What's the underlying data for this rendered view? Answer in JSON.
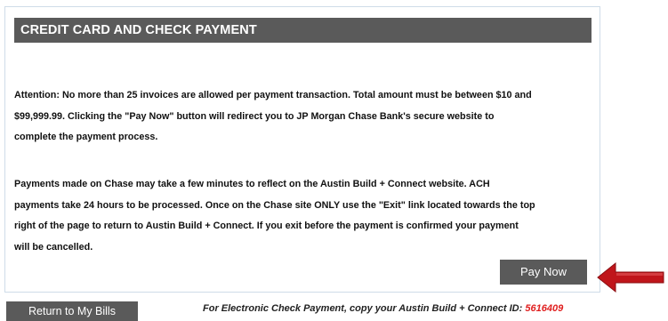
{
  "panel": {
    "title": "CREDIT CARD AND CHECK PAYMENT",
    "paragraph1_lines": [
      "Attention:  No more than 25 invoices are allowed per payment transaction.  Total amount must be between $10 and",
      "$99,999.99.  Clicking the \"Pay Now\" button will redirect you to JP Morgan Chase Bank's secure website to",
      "complete the payment process."
    ],
    "paragraph2_lines": [
      "Payments made on Chase may take a few minutes to reflect on the Austin Build + Connect website.  ACH",
      "payments take 24 hours to be processed. Once on the Chase site ONLY use the \"Exit\" link located towards the top",
      "right of the page to return to Austin Build + Connect.  If you exit before the payment is confirmed your payment",
      "will be cancelled."
    ],
    "pay_now_label": "Pay Now"
  },
  "arrow": {
    "icon": "left-arrow-icon",
    "color": "#c0151b"
  },
  "footer": {
    "return_label": "Return to My Bills",
    "note_text": "For Electronic Check Payment, copy your Austin Build + Connect ID: ",
    "connect_id": "5616409"
  },
  "colors": {
    "header_bg": "#5a5a5a",
    "panel_border": "#cfdce8",
    "id_color": "#e02020"
  }
}
